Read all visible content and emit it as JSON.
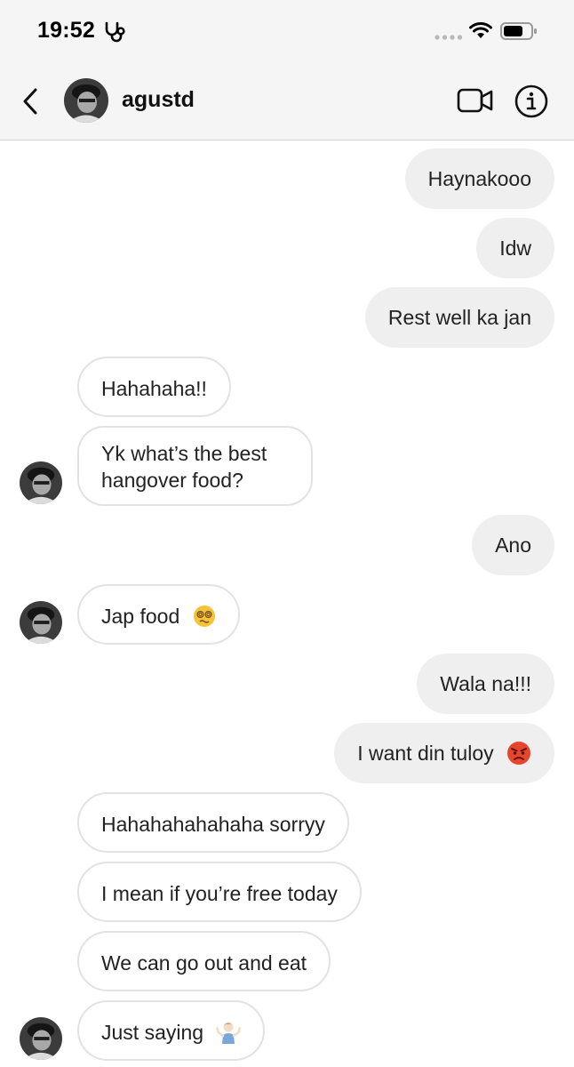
{
  "status_bar": {
    "time": "19:52",
    "health_icon": "stethoscope-icon",
    "signal_icon": "signal-dots-icon",
    "wifi_icon": "wifi-icon",
    "battery_icon": "battery-icon"
  },
  "header": {
    "back_icon": "chevron-left-icon",
    "username": "agustd",
    "video_icon": "video-camera-icon",
    "info_icon": "info-icon"
  },
  "messages": [
    {
      "sender": "me",
      "text": "Haynakooo"
    },
    {
      "sender": "me",
      "text": "Idw"
    },
    {
      "sender": "me",
      "text": "Rest well ka jan"
    },
    {
      "sender": "them",
      "text": "Hahahaha!!"
    },
    {
      "sender": "them",
      "text": "Yk what’s the best hangover food?"
    },
    {
      "sender": "me",
      "text": "Ano"
    },
    {
      "sender": "them",
      "text": "Jap food",
      "emoji": "dizzy-face-emoji"
    },
    {
      "sender": "me",
      "text": "Wala na!!!"
    },
    {
      "sender": "me",
      "text": "I want din tuloy",
      "emoji": "angry-face-emoji"
    },
    {
      "sender": "them",
      "text": "Hahahahahahaha sorryy"
    },
    {
      "sender": "them",
      "text": "I mean if you’re free today"
    },
    {
      "sender": "them",
      "text": "We can go out and eat"
    },
    {
      "sender": "them",
      "text": "Just saying",
      "emoji": "person-shrugging-emoji"
    }
  ],
  "colors": {
    "header_background": "#f5f5f5",
    "outgoing_bubble": "#efefef",
    "incoming_border": "#e2e2e2",
    "text": "#222222"
  }
}
